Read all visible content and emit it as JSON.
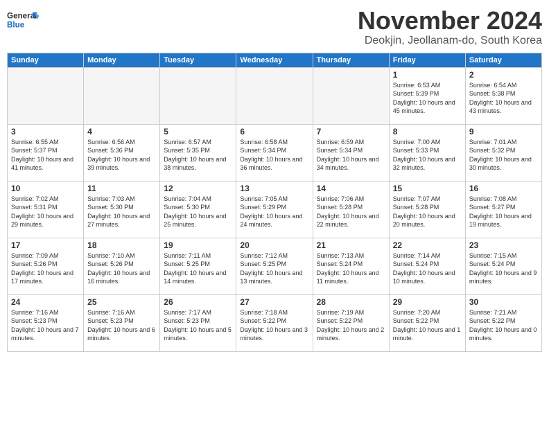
{
  "header": {
    "logo_general": "General",
    "logo_blue": "Blue",
    "month_title": "November 2024",
    "subtitle": "Deokjin, Jeollanam-do, South Korea"
  },
  "days_of_week": [
    "Sunday",
    "Monday",
    "Tuesday",
    "Wednesday",
    "Thursday",
    "Friday",
    "Saturday"
  ],
  "weeks": [
    [
      {
        "day": "",
        "empty": true
      },
      {
        "day": "",
        "empty": true
      },
      {
        "day": "",
        "empty": true
      },
      {
        "day": "",
        "empty": true
      },
      {
        "day": "",
        "empty": true
      },
      {
        "day": "1",
        "sunrise": "Sunrise: 6:53 AM",
        "sunset": "Sunset: 5:39 PM",
        "daylight": "Daylight: 10 hours and 45 minutes."
      },
      {
        "day": "2",
        "sunrise": "Sunrise: 6:54 AM",
        "sunset": "Sunset: 5:38 PM",
        "daylight": "Daylight: 10 hours and 43 minutes."
      }
    ],
    [
      {
        "day": "3",
        "sunrise": "Sunrise: 6:55 AM",
        "sunset": "Sunset: 5:37 PM",
        "daylight": "Daylight: 10 hours and 41 minutes."
      },
      {
        "day": "4",
        "sunrise": "Sunrise: 6:56 AM",
        "sunset": "Sunset: 5:36 PM",
        "daylight": "Daylight: 10 hours and 39 minutes."
      },
      {
        "day": "5",
        "sunrise": "Sunrise: 6:57 AM",
        "sunset": "Sunset: 5:35 PM",
        "daylight": "Daylight: 10 hours and 38 minutes."
      },
      {
        "day": "6",
        "sunrise": "Sunrise: 6:58 AM",
        "sunset": "Sunset: 5:34 PM",
        "daylight": "Daylight: 10 hours and 36 minutes."
      },
      {
        "day": "7",
        "sunrise": "Sunrise: 6:59 AM",
        "sunset": "Sunset: 5:34 PM",
        "daylight": "Daylight: 10 hours and 34 minutes."
      },
      {
        "day": "8",
        "sunrise": "Sunrise: 7:00 AM",
        "sunset": "Sunset: 5:33 PM",
        "daylight": "Daylight: 10 hours and 32 minutes."
      },
      {
        "day": "9",
        "sunrise": "Sunrise: 7:01 AM",
        "sunset": "Sunset: 5:32 PM",
        "daylight": "Daylight: 10 hours and 30 minutes."
      }
    ],
    [
      {
        "day": "10",
        "sunrise": "Sunrise: 7:02 AM",
        "sunset": "Sunset: 5:31 PM",
        "daylight": "Daylight: 10 hours and 29 minutes."
      },
      {
        "day": "11",
        "sunrise": "Sunrise: 7:03 AM",
        "sunset": "Sunset: 5:30 PM",
        "daylight": "Daylight: 10 hours and 27 minutes."
      },
      {
        "day": "12",
        "sunrise": "Sunrise: 7:04 AM",
        "sunset": "Sunset: 5:30 PM",
        "daylight": "Daylight: 10 hours and 25 minutes."
      },
      {
        "day": "13",
        "sunrise": "Sunrise: 7:05 AM",
        "sunset": "Sunset: 5:29 PM",
        "daylight": "Daylight: 10 hours and 24 minutes."
      },
      {
        "day": "14",
        "sunrise": "Sunrise: 7:06 AM",
        "sunset": "Sunset: 5:28 PM",
        "daylight": "Daylight: 10 hours and 22 minutes."
      },
      {
        "day": "15",
        "sunrise": "Sunrise: 7:07 AM",
        "sunset": "Sunset: 5:28 PM",
        "daylight": "Daylight: 10 hours and 20 minutes."
      },
      {
        "day": "16",
        "sunrise": "Sunrise: 7:08 AM",
        "sunset": "Sunset: 5:27 PM",
        "daylight": "Daylight: 10 hours and 19 minutes."
      }
    ],
    [
      {
        "day": "17",
        "sunrise": "Sunrise: 7:09 AM",
        "sunset": "Sunset: 5:26 PM",
        "daylight": "Daylight: 10 hours and 17 minutes."
      },
      {
        "day": "18",
        "sunrise": "Sunrise: 7:10 AM",
        "sunset": "Sunset: 5:26 PM",
        "daylight": "Daylight: 10 hours and 16 minutes."
      },
      {
        "day": "19",
        "sunrise": "Sunrise: 7:11 AM",
        "sunset": "Sunset: 5:25 PM",
        "daylight": "Daylight: 10 hours and 14 minutes."
      },
      {
        "day": "20",
        "sunrise": "Sunrise: 7:12 AM",
        "sunset": "Sunset: 5:25 PM",
        "daylight": "Daylight: 10 hours and 13 minutes."
      },
      {
        "day": "21",
        "sunrise": "Sunrise: 7:13 AM",
        "sunset": "Sunset: 5:24 PM",
        "daylight": "Daylight: 10 hours and 11 minutes."
      },
      {
        "day": "22",
        "sunrise": "Sunrise: 7:14 AM",
        "sunset": "Sunset: 5:24 PM",
        "daylight": "Daylight: 10 hours and 10 minutes."
      },
      {
        "day": "23",
        "sunrise": "Sunrise: 7:15 AM",
        "sunset": "Sunset: 5:24 PM",
        "daylight": "Daylight: 10 hours and 9 minutes."
      }
    ],
    [
      {
        "day": "24",
        "sunrise": "Sunrise: 7:16 AM",
        "sunset": "Sunset: 5:23 PM",
        "daylight": "Daylight: 10 hours and 7 minutes."
      },
      {
        "day": "25",
        "sunrise": "Sunrise: 7:16 AM",
        "sunset": "Sunset: 5:23 PM",
        "daylight": "Daylight: 10 hours and 6 minutes."
      },
      {
        "day": "26",
        "sunrise": "Sunrise: 7:17 AM",
        "sunset": "Sunset: 5:23 PM",
        "daylight": "Daylight: 10 hours and 5 minutes."
      },
      {
        "day": "27",
        "sunrise": "Sunrise: 7:18 AM",
        "sunset": "Sunset: 5:22 PM",
        "daylight": "Daylight: 10 hours and 3 minutes."
      },
      {
        "day": "28",
        "sunrise": "Sunrise: 7:19 AM",
        "sunset": "Sunset: 5:22 PM",
        "daylight": "Daylight: 10 hours and 2 minutes."
      },
      {
        "day": "29",
        "sunrise": "Sunrise: 7:20 AM",
        "sunset": "Sunset: 5:22 PM",
        "daylight": "Daylight: 10 hours and 1 minute."
      },
      {
        "day": "30",
        "sunrise": "Sunrise: 7:21 AM",
        "sunset": "Sunset: 5:22 PM",
        "daylight": "Daylight: 10 hours and 0 minutes."
      }
    ]
  ]
}
